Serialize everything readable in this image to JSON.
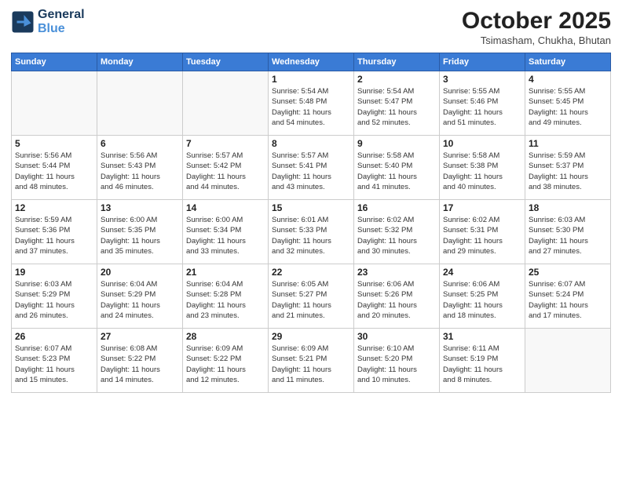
{
  "header": {
    "logo_line1": "General",
    "logo_line2": "Blue",
    "month": "October 2025",
    "location": "Tsimasham, Chukha, Bhutan"
  },
  "days_of_week": [
    "Sunday",
    "Monday",
    "Tuesday",
    "Wednesday",
    "Thursday",
    "Friday",
    "Saturday"
  ],
  "weeks": [
    [
      {
        "num": "",
        "info": []
      },
      {
        "num": "",
        "info": []
      },
      {
        "num": "",
        "info": []
      },
      {
        "num": "1",
        "info": [
          "Sunrise: 5:54 AM",
          "Sunset: 5:48 PM",
          "Daylight: 11 hours",
          "and 54 minutes."
        ]
      },
      {
        "num": "2",
        "info": [
          "Sunrise: 5:54 AM",
          "Sunset: 5:47 PM",
          "Daylight: 11 hours",
          "and 52 minutes."
        ]
      },
      {
        "num": "3",
        "info": [
          "Sunrise: 5:55 AM",
          "Sunset: 5:46 PM",
          "Daylight: 11 hours",
          "and 51 minutes."
        ]
      },
      {
        "num": "4",
        "info": [
          "Sunrise: 5:55 AM",
          "Sunset: 5:45 PM",
          "Daylight: 11 hours",
          "and 49 minutes."
        ]
      }
    ],
    [
      {
        "num": "5",
        "info": [
          "Sunrise: 5:56 AM",
          "Sunset: 5:44 PM",
          "Daylight: 11 hours",
          "and 48 minutes."
        ]
      },
      {
        "num": "6",
        "info": [
          "Sunrise: 5:56 AM",
          "Sunset: 5:43 PM",
          "Daylight: 11 hours",
          "and 46 minutes."
        ]
      },
      {
        "num": "7",
        "info": [
          "Sunrise: 5:57 AM",
          "Sunset: 5:42 PM",
          "Daylight: 11 hours",
          "and 44 minutes."
        ]
      },
      {
        "num": "8",
        "info": [
          "Sunrise: 5:57 AM",
          "Sunset: 5:41 PM",
          "Daylight: 11 hours",
          "and 43 minutes."
        ]
      },
      {
        "num": "9",
        "info": [
          "Sunrise: 5:58 AM",
          "Sunset: 5:40 PM",
          "Daylight: 11 hours",
          "and 41 minutes."
        ]
      },
      {
        "num": "10",
        "info": [
          "Sunrise: 5:58 AM",
          "Sunset: 5:38 PM",
          "Daylight: 11 hours",
          "and 40 minutes."
        ]
      },
      {
        "num": "11",
        "info": [
          "Sunrise: 5:59 AM",
          "Sunset: 5:37 PM",
          "Daylight: 11 hours",
          "and 38 minutes."
        ]
      }
    ],
    [
      {
        "num": "12",
        "info": [
          "Sunrise: 5:59 AM",
          "Sunset: 5:36 PM",
          "Daylight: 11 hours",
          "and 37 minutes."
        ]
      },
      {
        "num": "13",
        "info": [
          "Sunrise: 6:00 AM",
          "Sunset: 5:35 PM",
          "Daylight: 11 hours",
          "and 35 minutes."
        ]
      },
      {
        "num": "14",
        "info": [
          "Sunrise: 6:00 AM",
          "Sunset: 5:34 PM",
          "Daylight: 11 hours",
          "and 33 minutes."
        ]
      },
      {
        "num": "15",
        "info": [
          "Sunrise: 6:01 AM",
          "Sunset: 5:33 PM",
          "Daylight: 11 hours",
          "and 32 minutes."
        ]
      },
      {
        "num": "16",
        "info": [
          "Sunrise: 6:02 AM",
          "Sunset: 5:32 PM",
          "Daylight: 11 hours",
          "and 30 minutes."
        ]
      },
      {
        "num": "17",
        "info": [
          "Sunrise: 6:02 AM",
          "Sunset: 5:31 PM",
          "Daylight: 11 hours",
          "and 29 minutes."
        ]
      },
      {
        "num": "18",
        "info": [
          "Sunrise: 6:03 AM",
          "Sunset: 5:30 PM",
          "Daylight: 11 hours",
          "and 27 minutes."
        ]
      }
    ],
    [
      {
        "num": "19",
        "info": [
          "Sunrise: 6:03 AM",
          "Sunset: 5:29 PM",
          "Daylight: 11 hours",
          "and 26 minutes."
        ]
      },
      {
        "num": "20",
        "info": [
          "Sunrise: 6:04 AM",
          "Sunset: 5:29 PM",
          "Daylight: 11 hours",
          "and 24 minutes."
        ]
      },
      {
        "num": "21",
        "info": [
          "Sunrise: 6:04 AM",
          "Sunset: 5:28 PM",
          "Daylight: 11 hours",
          "and 23 minutes."
        ]
      },
      {
        "num": "22",
        "info": [
          "Sunrise: 6:05 AM",
          "Sunset: 5:27 PM",
          "Daylight: 11 hours",
          "and 21 minutes."
        ]
      },
      {
        "num": "23",
        "info": [
          "Sunrise: 6:06 AM",
          "Sunset: 5:26 PM",
          "Daylight: 11 hours",
          "and 20 minutes."
        ]
      },
      {
        "num": "24",
        "info": [
          "Sunrise: 6:06 AM",
          "Sunset: 5:25 PM",
          "Daylight: 11 hours",
          "and 18 minutes."
        ]
      },
      {
        "num": "25",
        "info": [
          "Sunrise: 6:07 AM",
          "Sunset: 5:24 PM",
          "Daylight: 11 hours",
          "and 17 minutes."
        ]
      }
    ],
    [
      {
        "num": "26",
        "info": [
          "Sunrise: 6:07 AM",
          "Sunset: 5:23 PM",
          "Daylight: 11 hours",
          "and 15 minutes."
        ]
      },
      {
        "num": "27",
        "info": [
          "Sunrise: 6:08 AM",
          "Sunset: 5:22 PM",
          "Daylight: 11 hours",
          "and 14 minutes."
        ]
      },
      {
        "num": "28",
        "info": [
          "Sunrise: 6:09 AM",
          "Sunset: 5:22 PM",
          "Daylight: 11 hours",
          "and 12 minutes."
        ]
      },
      {
        "num": "29",
        "info": [
          "Sunrise: 6:09 AM",
          "Sunset: 5:21 PM",
          "Daylight: 11 hours",
          "and 11 minutes."
        ]
      },
      {
        "num": "30",
        "info": [
          "Sunrise: 6:10 AM",
          "Sunset: 5:20 PM",
          "Daylight: 11 hours",
          "and 10 minutes."
        ]
      },
      {
        "num": "31",
        "info": [
          "Sunrise: 6:11 AM",
          "Sunset: 5:19 PM",
          "Daylight: 11 hours",
          "and 8 minutes."
        ]
      },
      {
        "num": "",
        "info": []
      }
    ]
  ]
}
